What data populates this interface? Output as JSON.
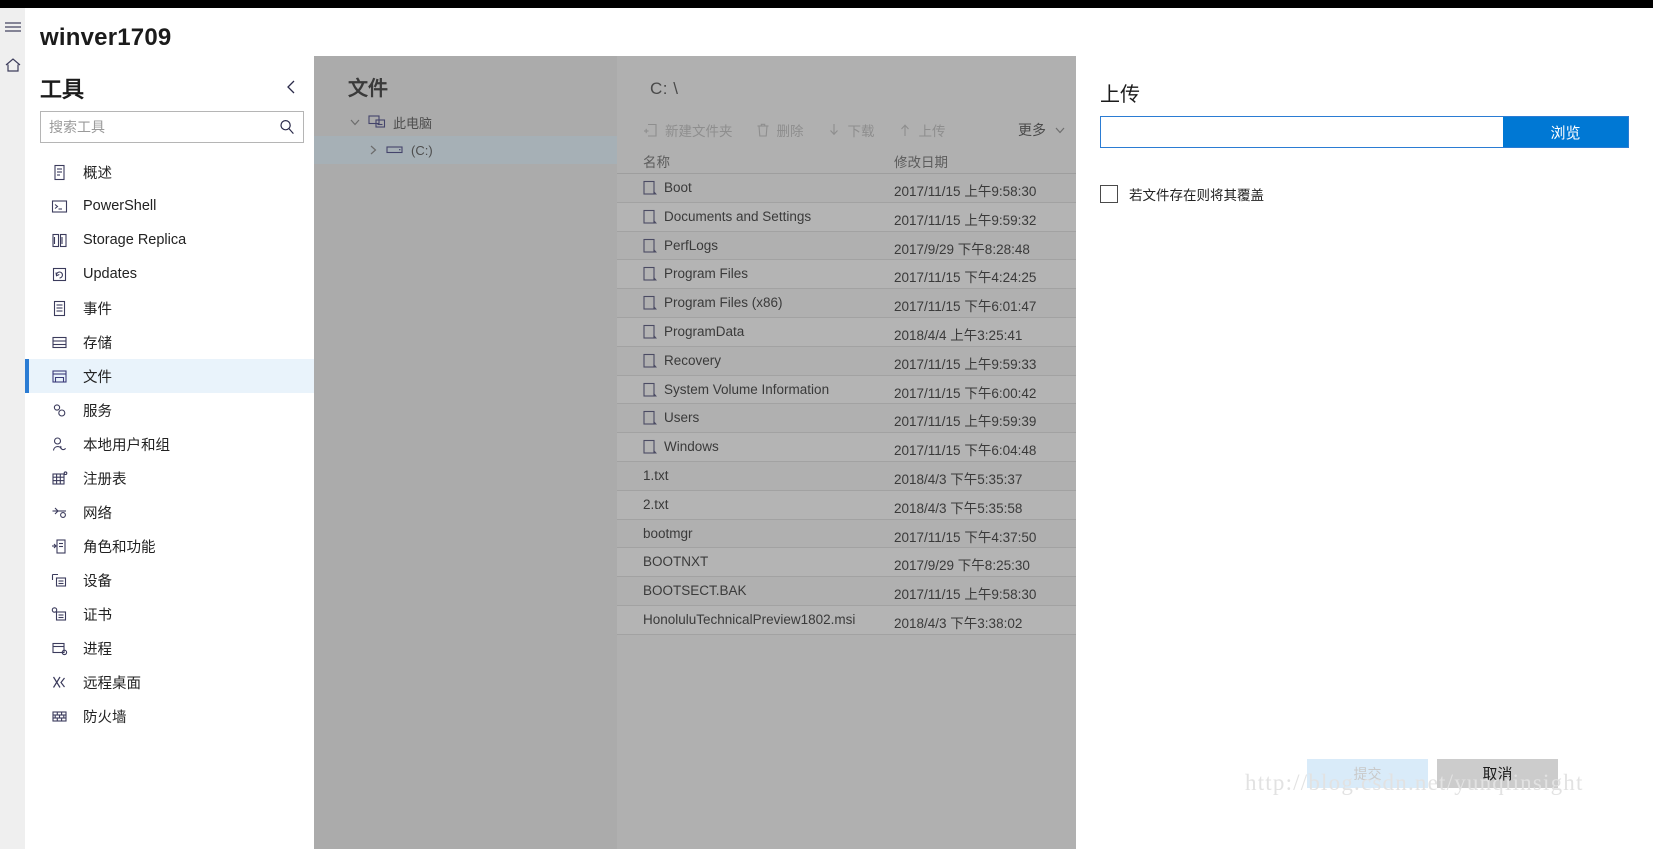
{
  "window": {
    "title": "winver1709"
  },
  "rail": {
    "hamburger_icon": "hamburger-menu-icon",
    "home_icon": "home-icon"
  },
  "tools": {
    "header": "工具",
    "collapse_icon": "chevron-left-icon",
    "search": {
      "placeholder": "搜索工具",
      "value": "",
      "icon": "search-icon"
    },
    "items": [
      {
        "label": "概述",
        "icon": "overview-icon",
        "selected": false
      },
      {
        "label": "PowerShell",
        "icon": "powershell-icon",
        "selected": false
      },
      {
        "label": "Storage Replica",
        "icon": "storage-replica-icon",
        "selected": false
      },
      {
        "label": "Updates",
        "icon": "updates-icon",
        "selected": false
      },
      {
        "label": "事件",
        "icon": "events-icon",
        "selected": false
      },
      {
        "label": "存储",
        "icon": "storage-icon",
        "selected": false
      },
      {
        "label": "文件",
        "icon": "files-icon",
        "selected": true
      },
      {
        "label": "服务",
        "icon": "services-icon",
        "selected": false
      },
      {
        "label": "本地用户和组",
        "icon": "local-users-icon",
        "selected": false
      },
      {
        "label": "注册表",
        "icon": "registry-icon",
        "selected": false
      },
      {
        "label": "网络",
        "icon": "network-icon",
        "selected": false
      },
      {
        "label": "角色和功能",
        "icon": "roles-features-icon",
        "selected": false
      },
      {
        "label": "设备",
        "icon": "devices-icon",
        "selected": false
      },
      {
        "label": "证书",
        "icon": "certificates-icon",
        "selected": false
      },
      {
        "label": "进程",
        "icon": "processes-icon",
        "selected": false
      },
      {
        "label": "远程桌面",
        "icon": "remote-desktop-icon",
        "selected": false
      },
      {
        "label": "防火墙",
        "icon": "firewall-icon",
        "selected": false
      }
    ]
  },
  "files_panel": {
    "title": "文件",
    "tree": {
      "root": {
        "label": "此电脑",
        "icon": "this-pc-icon",
        "expand_icon": "chevron-down-icon"
      },
      "child": {
        "label": "(C:)",
        "icon": "drive-icon",
        "expand_icon": "chevron-right-icon",
        "selected": true
      }
    },
    "path": "C: \\",
    "commands": [
      {
        "label": "新建文件夹",
        "icon": "new-folder-icon"
      },
      {
        "label": "删除",
        "icon": "trash-icon"
      },
      {
        "label": "下载",
        "icon": "download-arrow-icon"
      },
      {
        "label": "上传",
        "icon": "upload-arrow-icon"
      }
    ],
    "more": {
      "label": "更多",
      "icon": "chevron-down-icon"
    },
    "columns": {
      "name": "名称",
      "modified": "修改日期"
    },
    "rows": [
      {
        "name": "Boot",
        "modified": "2017/11/15 上午9:58:30",
        "folder": true
      },
      {
        "name": "Documents and Settings",
        "modified": "2017/11/15 上午9:59:32",
        "folder": true
      },
      {
        "name": "PerfLogs",
        "modified": "2017/9/29 下午8:28:48",
        "folder": true
      },
      {
        "name": "Program Files",
        "modified": "2017/11/15 下午4:24:25",
        "folder": true
      },
      {
        "name": "Program Files (x86)",
        "modified": "2017/11/15 下午6:01:47",
        "folder": true
      },
      {
        "name": "ProgramData",
        "modified": "2018/4/4 上午3:25:41",
        "folder": true
      },
      {
        "name": "Recovery",
        "modified": "2017/11/15 上午9:59:33",
        "folder": true
      },
      {
        "name": "System Volume Information",
        "modified": "2017/11/15 下午6:00:42",
        "folder": true
      },
      {
        "name": "Users",
        "modified": "2017/11/15 上午9:59:39",
        "folder": true
      },
      {
        "name": "Windows",
        "modified": "2017/11/15 下午6:04:48",
        "folder": true
      },
      {
        "name": "1.txt",
        "modified": "2018/4/3 下午5:35:37",
        "folder": false
      },
      {
        "name": "2.txt",
        "modified": "2018/4/3 下午5:35:58",
        "folder": false
      },
      {
        "name": "bootmgr",
        "modified": "2017/11/15 下午4:37:50",
        "folder": false
      },
      {
        "name": "BOOTNXT",
        "modified": "2017/9/29 下午8:25:30",
        "folder": false
      },
      {
        "name": "BOOTSECT.BAK",
        "modified": "2017/11/15 上午9:58:30",
        "folder": false
      },
      {
        "name": "HonoluluTechnicalPreview1802.msi",
        "modified": "2018/4/3 下午3:38:02",
        "folder": false
      }
    ]
  },
  "upload_dialog": {
    "title": "上传",
    "file_input": {
      "value": "",
      "placeholder": ""
    },
    "browse_label": "浏览",
    "overwrite_label": "若文件存在则将其覆盖",
    "overwrite_checked": false,
    "submit_label": "提交",
    "cancel_label": "取消"
  },
  "watermark": "http://blog.csdn.net/yunqiinsight",
  "colors": {
    "accent": "#0078d4",
    "selected_tool_bg": "#e9f3fb",
    "selected_tool_bar": "#2b7cd3",
    "dim_overlay": "#ababab",
    "dialog_bg": "#ffffff",
    "cancel_btn": "#cccccc",
    "submit_btn": "#d9ebf9"
  }
}
